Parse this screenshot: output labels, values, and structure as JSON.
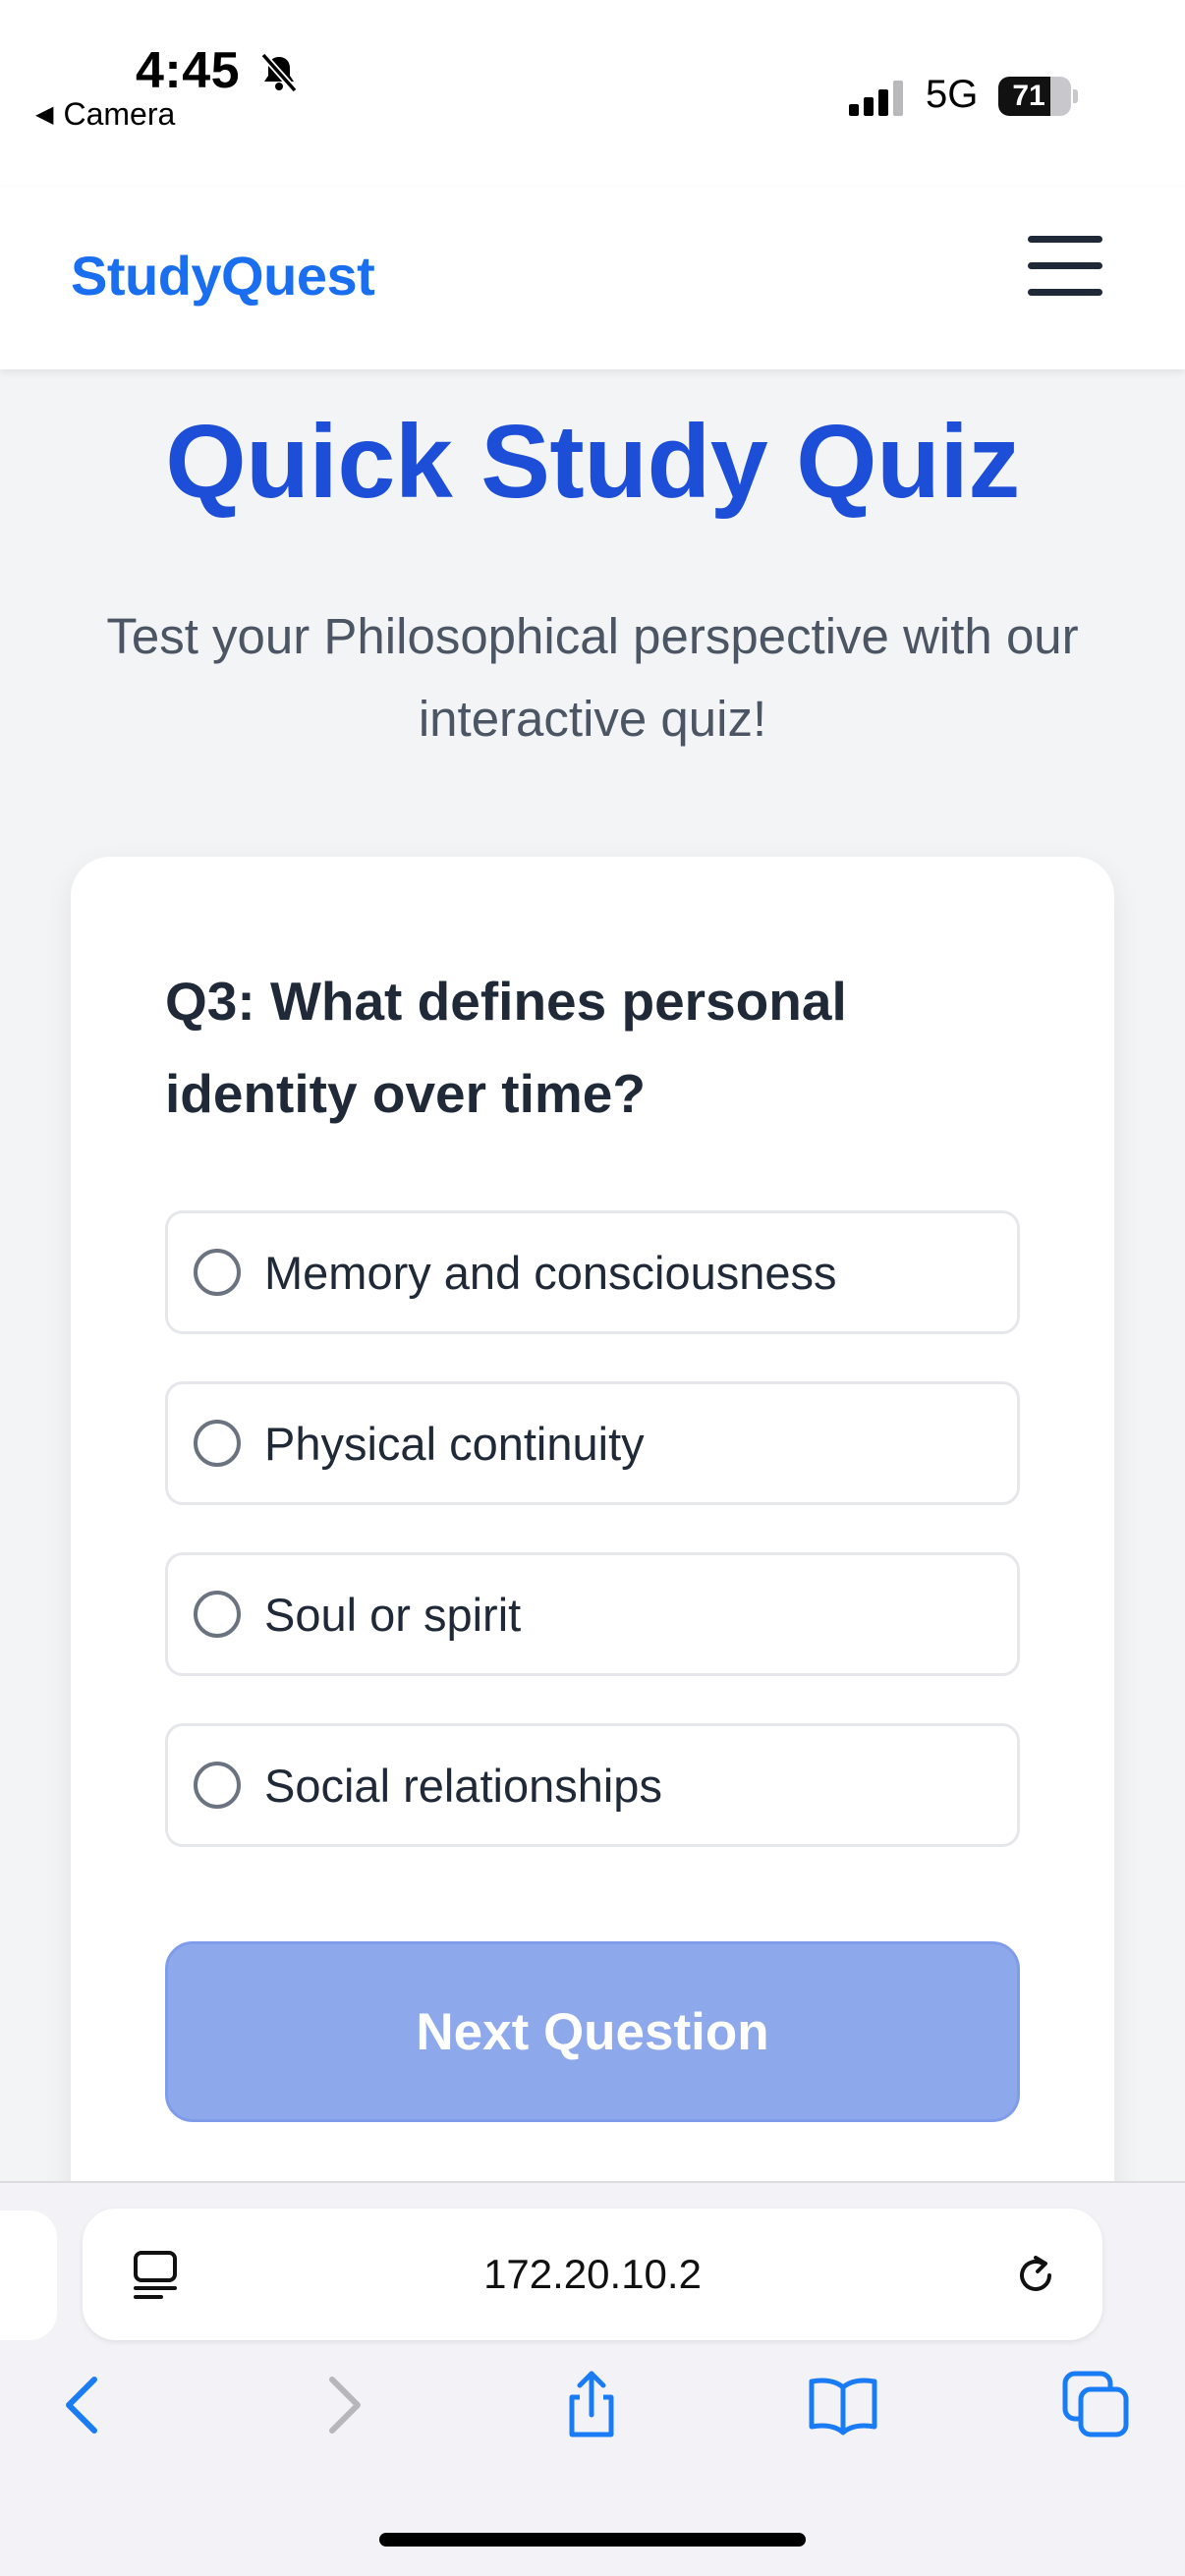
{
  "status_bar": {
    "time": "4:45",
    "back_app": "Camera",
    "network": "5G",
    "battery_percent": "71",
    "battery_level": 0.71
  },
  "app": {
    "brand": "StudyQuest"
  },
  "hero": {
    "title": "Quick Study Quiz",
    "subtitle": "Test your Philosophical perspective with our interactive quiz!"
  },
  "quiz": {
    "question": "Q3: What defines personal identity over time?",
    "options": [
      "Memory and consciousness",
      "Physical continuity",
      "Soul or spirit",
      "Social relationships"
    ],
    "next_label": "Next Question"
  },
  "browser": {
    "url": "172.20.10.2"
  },
  "colors": {
    "brand": "#1a6ef0",
    "title": "#1d4ed8",
    "button_disabled": "#8ea8ec",
    "ios_blue": "#1a7cf5"
  }
}
